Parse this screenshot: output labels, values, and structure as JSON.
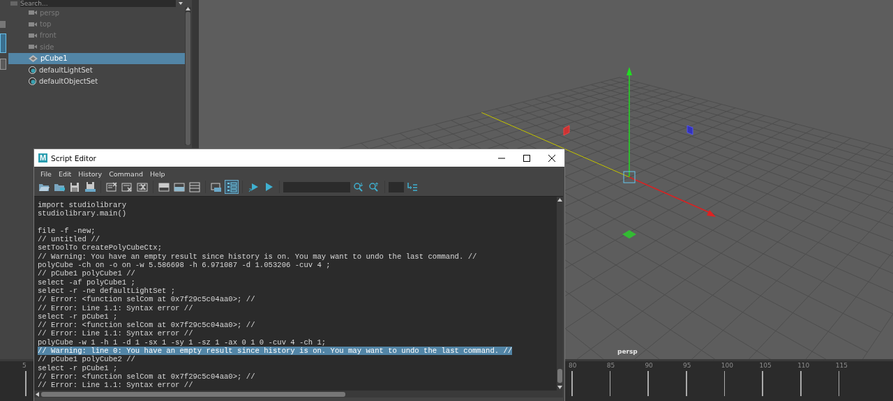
{
  "outliner": {
    "search": {
      "placeholder": "Search..."
    },
    "items": [
      {
        "label": "persp",
        "kind": "camera",
        "dimmed": true,
        "selected": false
      },
      {
        "label": "top",
        "kind": "camera",
        "dimmed": true,
        "selected": false
      },
      {
        "label": "front",
        "kind": "camera",
        "dimmed": true,
        "selected": false
      },
      {
        "label": "side",
        "kind": "camera",
        "dimmed": true,
        "selected": false
      },
      {
        "label": "pCube1",
        "kind": "mesh",
        "dimmed": false,
        "selected": true
      },
      {
        "label": "defaultLightSet",
        "kind": "set",
        "dimmed": false,
        "selected": false
      },
      {
        "label": "defaultObjectSet",
        "kind": "set",
        "dimmed": false,
        "selected": false
      }
    ]
  },
  "viewport": {
    "camera_label": "persp"
  },
  "timeline": {
    "ticks": [
      "5",
      "80",
      "85",
      "90",
      "95",
      "100",
      "105",
      "110",
      "115"
    ]
  },
  "script_editor": {
    "logo": "M",
    "title": "Script Editor",
    "menu": [
      "File",
      "Edit",
      "History",
      "Command",
      "Help"
    ],
    "toolbar": [
      {
        "kind": "open",
        "on": false
      },
      {
        "kind": "import",
        "on": false
      },
      {
        "kind": "save",
        "on": false
      },
      {
        "kind": "save-shelf",
        "on": false
      },
      {
        "kind": "clear-history",
        "on": false
      },
      {
        "kind": "clear-input",
        "on": false
      },
      {
        "kind": "clear-all",
        "on": false
      },
      {
        "kind": "show-history",
        "on": false
      },
      {
        "kind": "show-input",
        "on": false
      },
      {
        "kind": "show-both",
        "on": false
      },
      {
        "kind": "echo",
        "on": false
      },
      {
        "kind": "line-numbers",
        "on": true
      },
      {
        "kind": "execute-all",
        "on": false
      },
      {
        "kind": "execute",
        "on": false
      },
      {
        "kind": "search-field"
      },
      {
        "kind": "search-down",
        "on": false
      },
      {
        "kind": "search-up",
        "on": false
      },
      {
        "kind": "line-field"
      },
      {
        "kind": "goto-line",
        "on": false
      }
    ],
    "lines": [
      {
        "kind": "code",
        "text": "import studiolibrary",
        "selected": false
      },
      {
        "kind": "code",
        "text": "studiolibrary.main()",
        "selected": false
      },
      {
        "kind": "blank"
      },
      {
        "kind": "code",
        "text": "file -f -new;",
        "selected": false
      },
      {
        "kind": "code",
        "text": "// untitled //",
        "selected": false
      },
      {
        "kind": "code",
        "text": "setToolTo CreatePolyCubeCtx;",
        "selected": false
      },
      {
        "kind": "code",
        "text": "// Warning: You have an empty result since history is on. You may want to undo the last command. //",
        "selected": false
      },
      {
        "kind": "code",
        "text": "polyCube -ch on -o on -w 5.586698 -h 6.971087 -d 1.053206 -cuv 4 ;",
        "selected": false
      },
      {
        "kind": "code",
        "text": "// pCube1 polyCube1 //",
        "selected": false
      },
      {
        "kind": "code",
        "text": "select -af polyCube1 ;",
        "selected": false
      },
      {
        "kind": "code",
        "text": "select -r -ne defaultLightSet ;",
        "selected": false
      },
      {
        "kind": "code",
        "text": "// Error: <function selCom at 0x7f29c5c04aa0>; //",
        "selected": false
      },
      {
        "kind": "code",
        "text": "// Error: Line 1.1: Syntax error //",
        "selected": false
      },
      {
        "kind": "code",
        "text": "select -r pCube1 ;",
        "selected": false
      },
      {
        "kind": "code",
        "text": "// Error: <function selCom at 0x7f29c5c04aa0>; //",
        "selected": false
      },
      {
        "kind": "code",
        "text": "// Error: Line 1.1: Syntax error //",
        "selected": false
      },
      {
        "kind": "code",
        "text": "polyCube -w 1 -h 1 -d 1 -sx 1 -sy 1 -sz 1 -ax 0 1 0 -cuv 4 -ch 1;",
        "selected": false
      },
      {
        "kind": "code",
        "text": "// Warning: line 0: You have an empty result since history is on. You may want to undo the last command. //",
        "selected": true
      },
      {
        "kind": "code",
        "text": "// pCube1 polyCube2 //",
        "selected": false
      },
      {
        "kind": "code",
        "text": "select -r pCube1 ;",
        "selected": false
      },
      {
        "kind": "code",
        "text": "// Error: <function selCom at 0x7f29c5c04aa0>; //",
        "selected": false
      },
      {
        "kind": "code",
        "text": "// Error: Line 1.1: Syntax error //",
        "selected": false
      }
    ]
  }
}
